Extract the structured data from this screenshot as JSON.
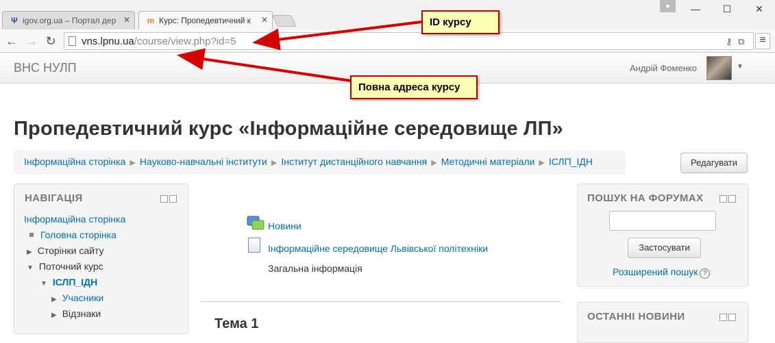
{
  "browser": {
    "tabs": [
      {
        "title": "igov.org.ua – Портал дер",
        "icon": "ukraine-trident-icon"
      },
      {
        "title": "Курс: Пропедевтичний к",
        "icon": "moodle-icon"
      }
    ],
    "url_host": "vns.lpnu.ua",
    "url_path": "/course/view.php?id=5"
  },
  "site": {
    "brand": "ВНС НУЛП",
    "user_name": "Андрій Фоменко"
  },
  "page": {
    "title": "Пропедевтичний курс «Інформаційне середовище ЛП»",
    "breadcrumb": [
      "Інформаційна сторінка",
      "Науково-навчальні інститути",
      "Інститут дистанційного навчання",
      "Методичні матеріали",
      "ІСЛП_ІДН"
    ],
    "edit_button": "Редагувати"
  },
  "navigation": {
    "title": "НАВІГАЦІЯ",
    "items": [
      {
        "label": "Інформаційна сторінка"
      },
      {
        "label": "Головна сторінка"
      },
      {
        "label": "Сторінки сайту"
      },
      {
        "label": "Поточний курс"
      },
      {
        "label": "ІСЛП_ІДН"
      },
      {
        "label": "Учасники"
      },
      {
        "label": "Відзнаки"
      }
    ]
  },
  "course": {
    "activities": [
      {
        "label": "Новини",
        "icon": "forum-icon"
      },
      {
        "label": "Інформаційне середовище Львівської політехніки",
        "icon": "page-icon"
      }
    ],
    "general_info": "Загальна інформація",
    "section_title": "Тема 1"
  },
  "forum_search": {
    "title": "ПОШУК НА ФОРУМАХ",
    "input_value": "",
    "button": "Застосувати",
    "advanced": "Розширений пошук"
  },
  "latest_news": {
    "title": "ОСТАННІ НОВИНИ"
  },
  "annotations": {
    "course_id": "ID курсу",
    "full_address": "Повна адреса курсу"
  }
}
